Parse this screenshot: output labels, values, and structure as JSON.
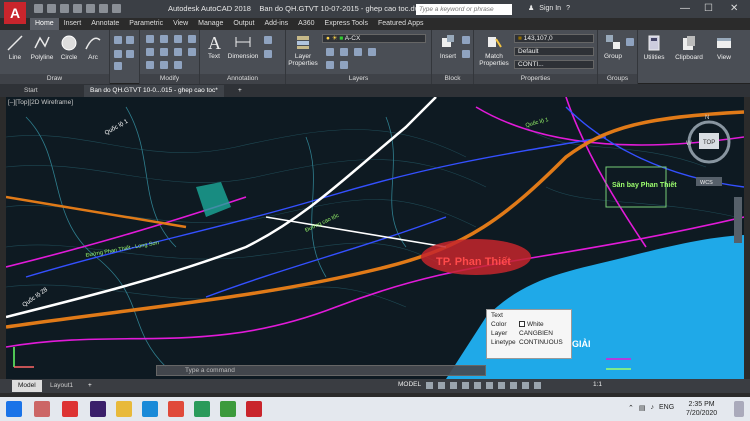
{
  "app": {
    "logo": "A",
    "product": "Autodesk AutoCAD 2018",
    "file": "Ban do QH.GTVT 10-07-2015 - ghep cao toc.dwg"
  },
  "title_bar": {
    "search_placeholder": "Type a keyword or phrase",
    "sign_in": "Sign In"
  },
  "ribbon_tabs": [
    "Home",
    "Insert",
    "Annotate",
    "Parametric",
    "View",
    "Manage",
    "Output",
    "Add-ins",
    "A360",
    "Express Tools",
    "Featured Apps"
  ],
  "panels": {
    "draw": {
      "title": "Draw",
      "tools": [
        "Line",
        "Polyline",
        "Circle",
        "Arc"
      ]
    },
    "modify": {
      "title": "Modify"
    },
    "annotation": {
      "title": "Annotation",
      "tools": [
        "Text",
        "Dimension"
      ]
    },
    "layers": {
      "title": "Layers",
      "layer_props": "Layer Properties",
      "current_layer": "A-CX"
    },
    "block": {
      "title": "Block",
      "insert": "Insert"
    },
    "properties": {
      "title": "Properties",
      "match": "Match Properties",
      "color": "143,107,0",
      "lineweight": "Default",
      "linetype": "CONTI..."
    },
    "groups": {
      "title": "Groups",
      "group": "Group"
    },
    "utilities": "Utilities",
    "clipboard": "Clipboard",
    "view": "View"
  },
  "file_tabs": [
    "Start",
    "Ban do QH.GTVT 10-0...015 - ghep cao toc*"
  ],
  "viewport": {
    "label": "[–][Top][2D Wireframe]",
    "map_labels": [
      "TP. Phan Thiết",
      "Sân bay Phan Thiết",
      "Quốc lộ 1",
      "Quốc lộ 28",
      "GIẢI"
    ],
    "viewcube": "TOP",
    "wcs": "WCS"
  },
  "tooltip": {
    "title": "Text",
    "rows": [
      {
        "key": "Color",
        "value": "White"
      },
      {
        "key": "Layer",
        "value": "CANGBIEN"
      },
      {
        "key": "Linetype",
        "value": "CONTINUOUS"
      }
    ]
  },
  "command": {
    "placeholder": "Type a command"
  },
  "layout_tabs": [
    "Model",
    "Layout1"
  ],
  "status": {
    "model": "MODEL",
    "scale": "1:1"
  },
  "taskbar": {
    "lang": "ENG",
    "time": "2:35 PM",
    "date": "7/20/2020"
  },
  "colors": {
    "title": "#3b3f45",
    "ribbon": "#4a4e55",
    "viewport_bg": "#0e1a22",
    "brand": "#c9252c"
  }
}
